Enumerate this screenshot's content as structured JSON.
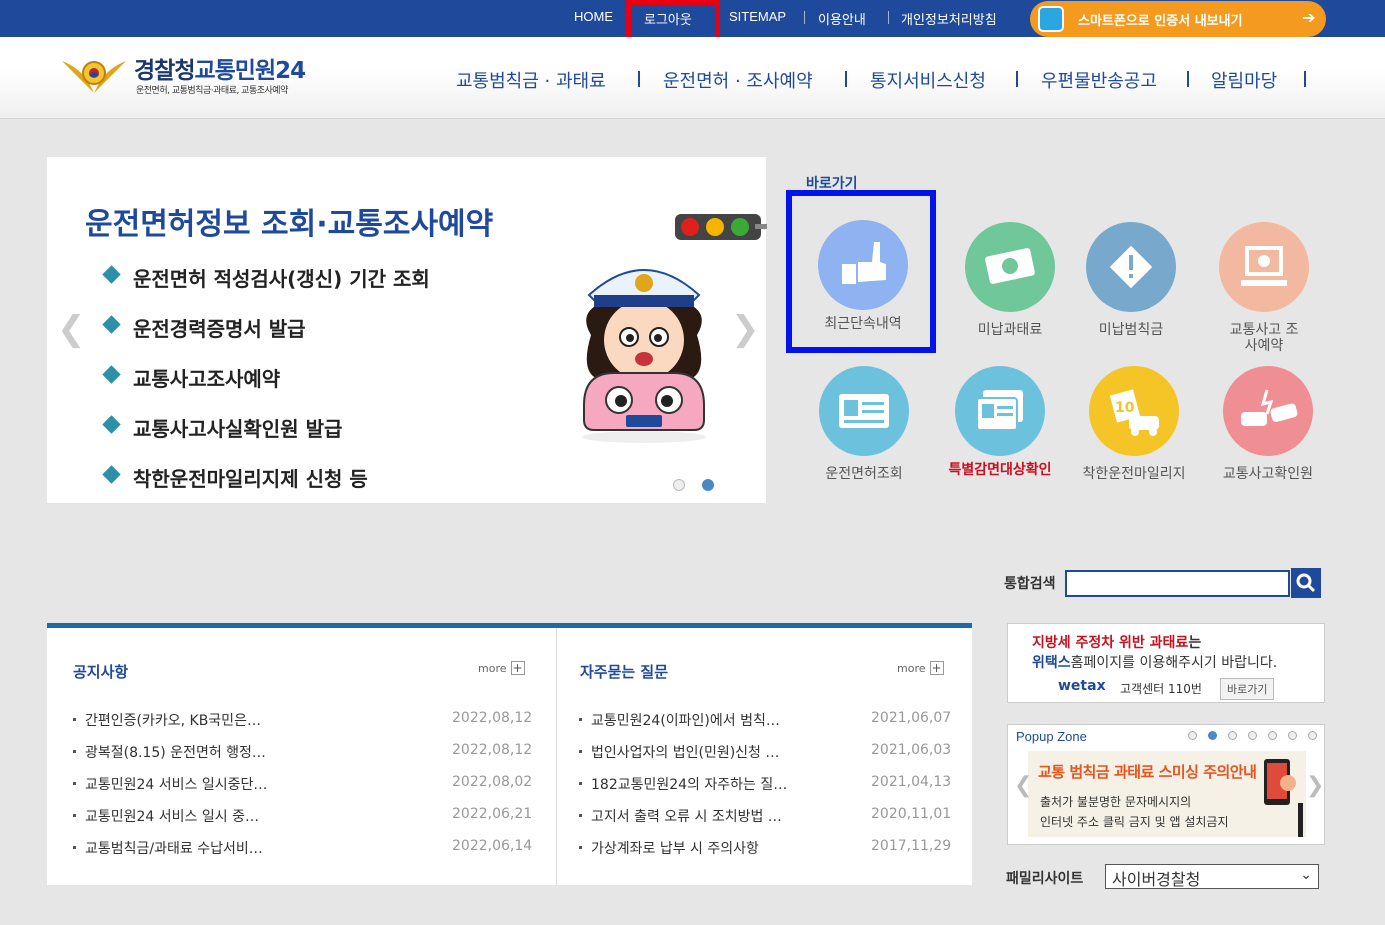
{
  "topbar": {
    "links": [
      "HOME",
      "로그아웃",
      "SITEMAP",
      "이용안내",
      "개인정보처리방침"
    ],
    "smartphone_banner": "스마트폰으로 인증서 내보내기"
  },
  "header": {
    "logo_title_1": "경찰청",
    "logo_title_2": "교통민원24",
    "logo_subtitle": "운전면허, 교통범칙금·과태료, 교통조사예약",
    "nav": [
      "교통범칙금 · 과태료",
      "운전면허 · 조사예약",
      "통지서비스신청",
      "우편물반송공고",
      "알림마당"
    ]
  },
  "slider": {
    "title": "운전면허정보 조회·교통조사예약",
    "items": [
      "운전면허 적성검사(갱신) 기간 조회",
      "운전경력증명서 발급",
      "교통사고조사예약",
      "교통사고사실확인원 발급",
      "착한운전마일리지제 신청 등"
    ]
  },
  "quick": {
    "title": "바로가기",
    "items": [
      {
        "label": "최근단속내역",
        "color": "#8fb2f0",
        "icon": "thumbs-up-icon"
      },
      {
        "label": "미납과태료",
        "color": "#6fc79a",
        "icon": "money-icon"
      },
      {
        "label": "미납범칙금",
        "color": "#78a9cc",
        "icon": "warning-icon"
      },
      {
        "label": "교통사고 조사예약",
        "color": "#f2b8a0",
        "icon": "monitor-icon"
      },
      {
        "label": "운전면허조회",
        "color": "#6cc2dc",
        "icon": "id-card-icon"
      },
      {
        "label": "특별감면대상확인",
        "color": "#6cc2dc",
        "icon": "document-icon"
      },
      {
        "label": "착한운전마일리지",
        "color": "#f5c427",
        "icon": "mileage-icon"
      },
      {
        "label": "교통사고확인원",
        "color": "#ef8f93",
        "icon": "car-crash-icon"
      }
    ]
  },
  "search": {
    "label": "통합검색",
    "placeholder": ""
  },
  "notice": {
    "title": "공지사항",
    "more": "more",
    "rows": [
      {
        "title": "간편인증(카카오, KB국민은…",
        "date": "2022,08,12"
      },
      {
        "title": "광복절(8.15) 운전면허 행정…",
        "date": "2022,08,12"
      },
      {
        "title": "교통민원24 서비스 일시중단…",
        "date": "2022,08,02"
      },
      {
        "title": "교통민원24 서비스 일시 중…",
        "date": "2022,06,21"
      },
      {
        "title": "교통범칙금/과태료 수납서비…",
        "date": "2022,06,14"
      }
    ]
  },
  "faq": {
    "title": "자주묻는 질문",
    "more": "more",
    "rows": [
      {
        "title": "교통민원24(이파인)에서 범칙…",
        "date": "2021,06,07"
      },
      {
        "title": "법인사업자의 법인(민원)신청 …",
        "date": "2021,06,03"
      },
      {
        "title": "182교통민원24의 자주하는 질…",
        "date": "2021,04,13"
      },
      {
        "title": "고지서 출력 오류 시 조치방법 …",
        "date": "2020,11,01"
      },
      {
        "title": "가상계좌로 납부 시 주의사항",
        "date": "2017,11,29"
      }
    ]
  },
  "wetax": {
    "line1a": "지방세 주정차 위반 과태료",
    "line1b": "는",
    "line2a": "위택스",
    "line2b": "홈페이지를 이용해주시기 바랍니다.",
    "logo": "wetax",
    "center": "고객센터 110번",
    "button": "바로가기"
  },
  "popup": {
    "title": "Popup Zone",
    "headline": "교통 범칙금 과태료 스미싱 주의안내",
    "line1": "출처가 불분명한 문자메시지의",
    "line2": "인터넷 주소 클릭 금지 및 앱 설치금지"
  },
  "family": {
    "label": "패밀리사이트",
    "selected": "사이버경찰청"
  }
}
